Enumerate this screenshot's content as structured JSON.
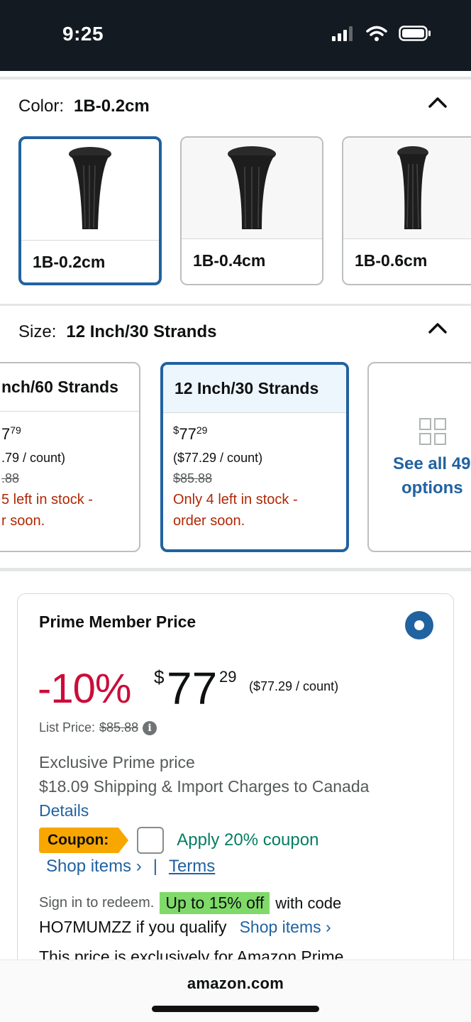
{
  "status_bar": {
    "time": "9:25"
  },
  "color_section": {
    "label": "Color:",
    "selected": "1B-0.2cm",
    "options": [
      {
        "name": "1B-0.2cm"
      },
      {
        "name": "1B-0.4cm"
      },
      {
        "name": "1B-0.6cm"
      }
    ]
  },
  "size_section": {
    "label": "Size:",
    "selected": "12 Inch/30 Strands",
    "options": [
      {
        "title": "nch/60 Strands",
        "price_whole": "7",
        "price_frac": "79",
        "unit": ".79 / count)",
        "list": ".88",
        "stock_1": "5 left in stock -",
        "stock_2": "r soon."
      },
      {
        "title": "12 Inch/30 Strands",
        "price_cur": "$",
        "price_whole": "77",
        "price_frac": "29",
        "unit": "($77.29 / count)",
        "list": "$85.88",
        "stock_1": "Only 4 left in stock -",
        "stock_2": "order soon."
      }
    ],
    "see_all": {
      "line1": "See all 49",
      "line2": "options"
    }
  },
  "prime_box": {
    "title": "Prime Member Price",
    "discount": "-10%",
    "price_currency": "$",
    "price_whole": "77",
    "price_fraction": "29",
    "unit_price": "($77.29 / count)",
    "list_price_label": "List Price:",
    "list_price": "$85.88",
    "exclusive": "Exclusive Prime price",
    "shipping": "$18.09 Shipping & Import Charges to Canada",
    "details": "Details",
    "coupon_label": "Coupon:",
    "apply_coupon": "Apply 20% coupon",
    "shop_items": "Shop items ›",
    "separator": "|",
    "terms": "Terms",
    "sign_in": "Sign in to redeem.",
    "promo": "Up to 15% off",
    "with_code": "with code",
    "code_text": "HO7MUMZZ if you qualify",
    "shop_items_2": "Shop items ›",
    "cut_text": "This price is exclusively for Amazon Prime"
  },
  "bottom_bar": {
    "domain": "amazon.com"
  },
  "colors": {
    "accent": "#2162a1",
    "deal_red": "#cc0c39",
    "stock_red": "#b12704",
    "coupon_orange": "#f7a700",
    "promo_green": "#7fda69",
    "coupon_green": "#067d62"
  }
}
